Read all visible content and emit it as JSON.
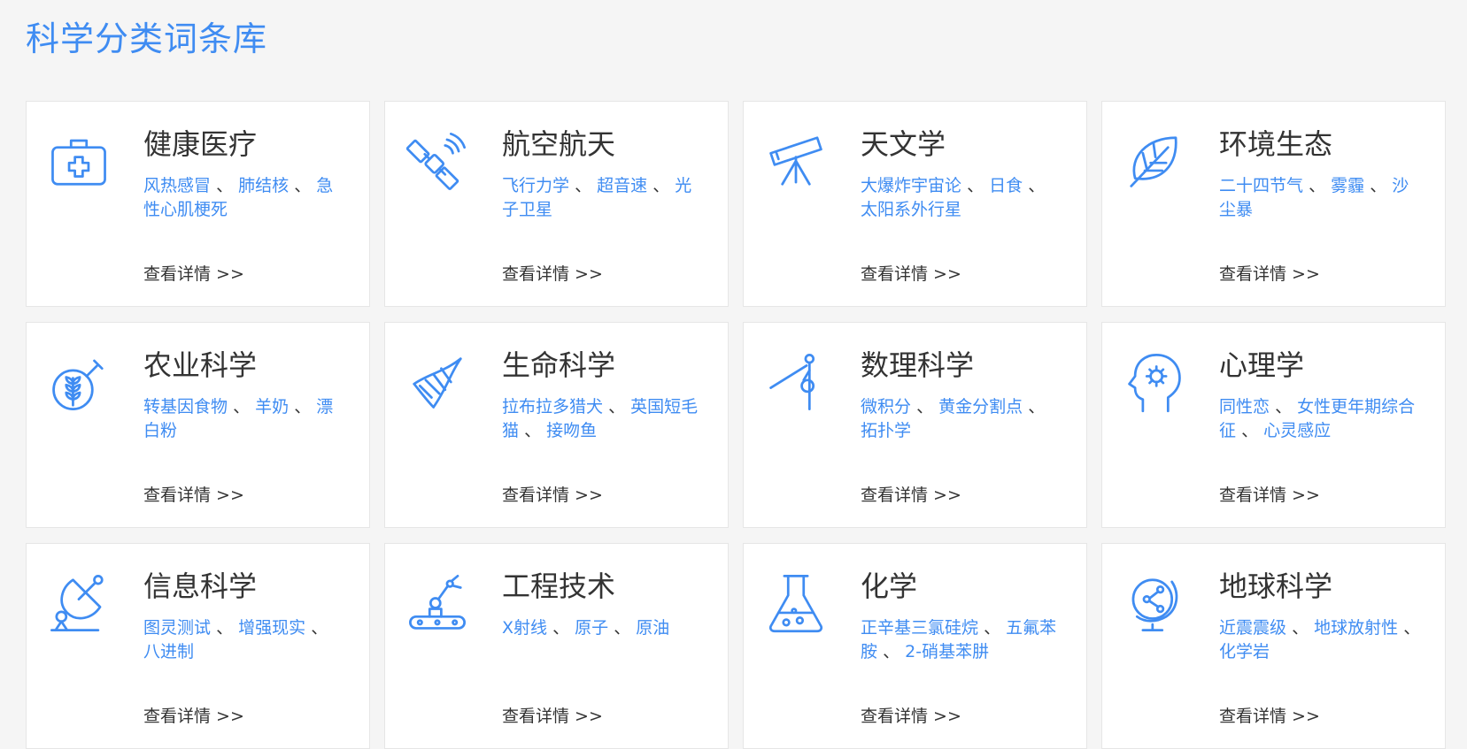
{
  "page": {
    "title": "科学分类词条库"
  },
  "colors": {
    "accent": "#3f8cf2",
    "text": "#333333",
    "background": "#f5f5f5",
    "card": "#ffffff",
    "border": "#e6e6e6"
  },
  "separator": "、",
  "categories": [
    {
      "id": "health",
      "icon": "medical-kit-icon",
      "title": "健康医疗",
      "terms": [
        "风热感冒",
        "肺结核",
        "急性心肌梗死"
      ],
      "link": "查看详情 >>"
    },
    {
      "id": "aerospace",
      "icon": "satellite-icon",
      "title": "航空航天",
      "terms": [
        "飞行力学",
        "超音速",
        "光子卫星"
      ],
      "link": "查看详情 >>"
    },
    {
      "id": "astronomy",
      "icon": "telescope-icon",
      "title": "天文学",
      "terms": [
        "大爆炸宇宙论",
        "日食",
        "太阳系外行星"
      ],
      "link": "查看详情 >>"
    },
    {
      "id": "ecology",
      "icon": "leaf-icon",
      "title": "环境生态",
      "terms": [
        "二十四节气",
        "雾霾",
        "沙尘暴"
      ],
      "link": "查看详情 >>"
    },
    {
      "id": "agriculture",
      "icon": "wheat-flask-icon",
      "title": "农业科学",
      "terms": [
        "转基因食物",
        "羊奶",
        "漂白粉"
      ],
      "link": "查看详情 >>"
    },
    {
      "id": "life",
      "icon": "dna-icon",
      "title": "生命科学",
      "terms": [
        "拉布拉多猎犬",
        "英国短毛猫",
        "接吻鱼"
      ],
      "link": "查看详情 >>"
    },
    {
      "id": "math",
      "icon": "compass-icon",
      "title": "数理科学",
      "terms": [
        "微积分",
        "黄金分割点",
        "拓扑学"
      ],
      "link": "查看详情 >>"
    },
    {
      "id": "psychology",
      "icon": "head-gear-icon",
      "title": "心理学",
      "terms": [
        "同性恋",
        "女性更年期综合征",
        "心灵感应"
      ],
      "link": "查看详情 >>"
    },
    {
      "id": "information",
      "icon": "satellite-dish-icon",
      "title": "信息科学",
      "terms": [
        "图灵测试",
        "增强现实",
        "八进制"
      ],
      "link": "查看详情 >>"
    },
    {
      "id": "engineering",
      "icon": "robot-arm-icon",
      "title": "工程技术",
      "terms": [
        "X射线",
        "原子",
        "原油"
      ],
      "link": "查看详情 >>"
    },
    {
      "id": "chemistry",
      "icon": "flask-icon",
      "title": "化学",
      "terms": [
        "正辛基三氯硅烷",
        "五氟苯胺",
        "2-硝基苯肼"
      ],
      "link": "查看详情 >>"
    },
    {
      "id": "earth",
      "icon": "globe-icon",
      "title": "地球科学",
      "terms": [
        "近震震级",
        "地球放射性",
        "化学岩"
      ],
      "link": "查看详情 >>"
    }
  ]
}
